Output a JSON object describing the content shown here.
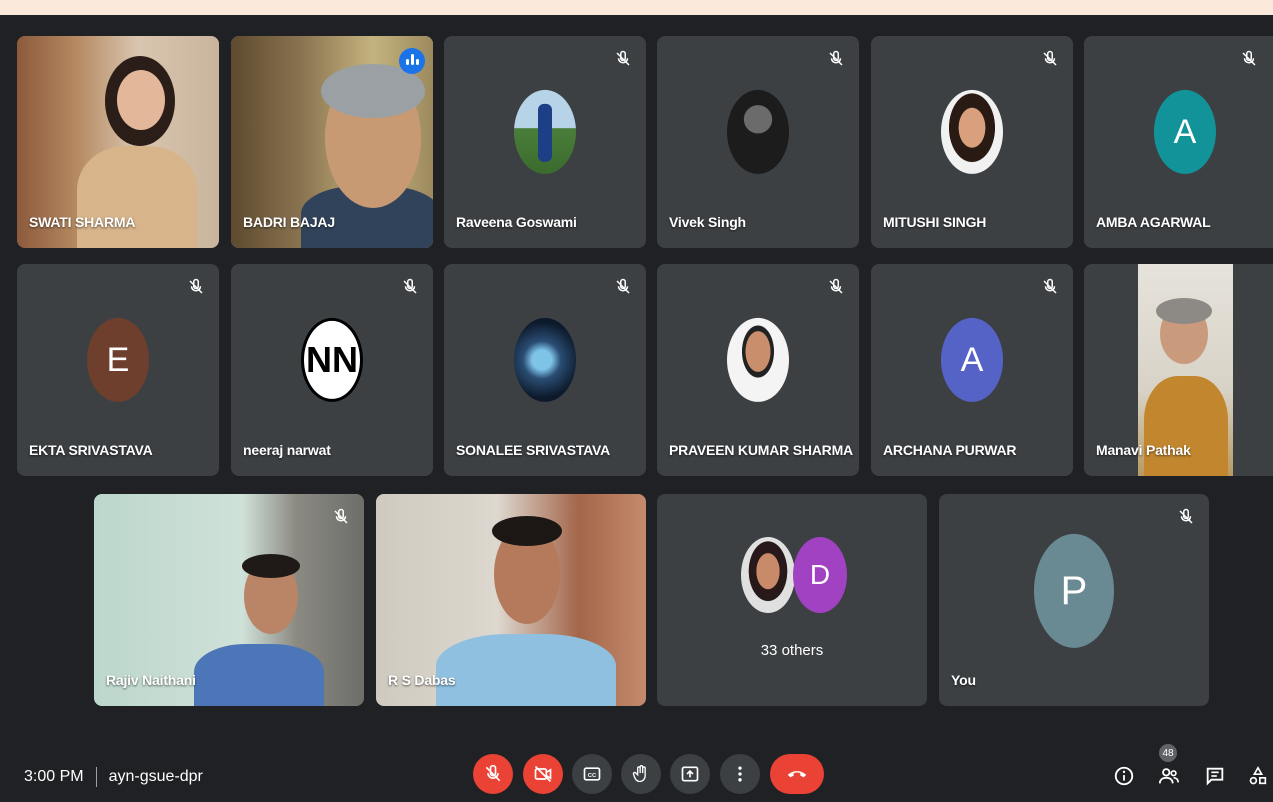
{
  "participants": [
    {
      "name": "SWATI SHARMA"
    },
    {
      "name": "BADRI BAJAJ"
    },
    {
      "name": "Raveena Goswami"
    },
    {
      "name": "Vivek Singh"
    },
    {
      "name": "MITUSHI SINGH"
    },
    {
      "name": "AMBA AGARWAL",
      "initial": "A",
      "color": "#12939a"
    },
    {
      "name": "EKTA SRIVASTAVA",
      "initial": "E",
      "color": "#6d3f2c"
    },
    {
      "name": "neeraj narwat",
      "initial": "NN"
    },
    {
      "name": "SONALEE SRIVASTAVA"
    },
    {
      "name": "PRAVEEN KUMAR SHARMA"
    },
    {
      "name": "ARCHANA PURWAR",
      "initial": "A",
      "color": "#5563c7"
    },
    {
      "name": "Manavi Pathak"
    },
    {
      "name": "Rajiv Naithani"
    },
    {
      "name": "R S Dabas"
    },
    {
      "name": "33 others",
      "initial": "D",
      "color": "#a142c3"
    },
    {
      "name": "You",
      "initial": "P",
      "color": "#6a8a93"
    }
  ],
  "meeting": {
    "time": "3:00 PM",
    "code": "ayn-gsue-dpr"
  },
  "people_count": "48",
  "icons": {
    "mic_off": "mic-off-icon",
    "cam_off": "videocam-off-icon",
    "captions": "closed-captions-icon",
    "raise_hand": "raise-hand-icon",
    "present": "present-screen-icon",
    "more": "more-options-icon",
    "end_call": "end-call-icon",
    "info": "info-icon",
    "people": "people-icon",
    "chat": "chat-icon",
    "activities": "activities-icon"
  },
  "colors": {
    "accent_red": "#ea4335",
    "speaking_blue": "#1a73e8",
    "tile_bg": "#3c4043",
    "meet_bg": "#202124"
  }
}
